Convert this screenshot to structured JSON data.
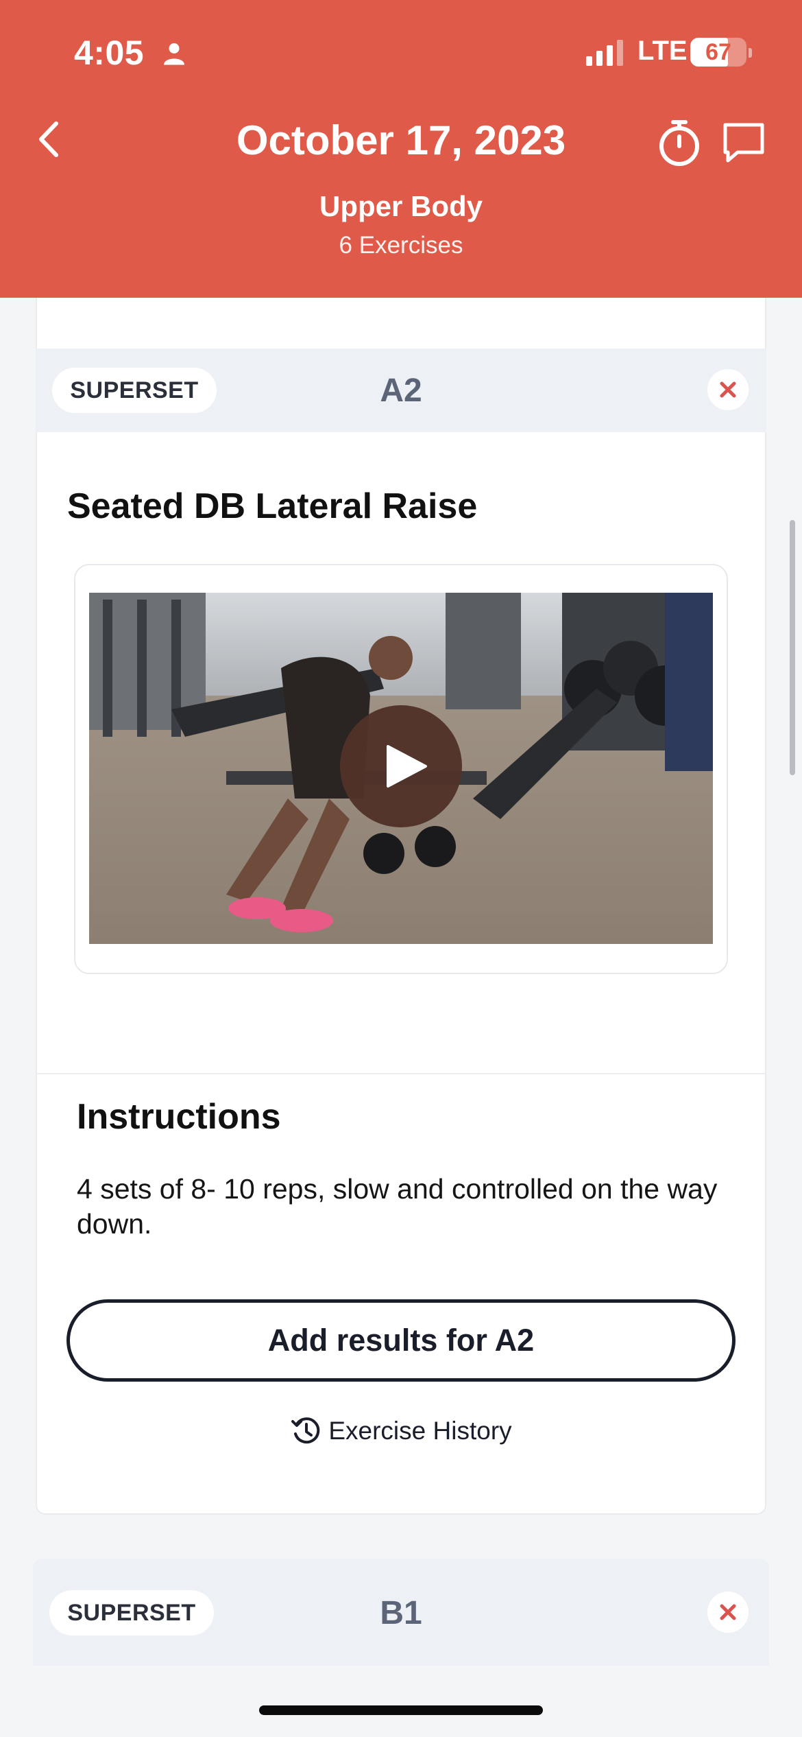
{
  "status_bar": {
    "time": "4:05",
    "network": "LTE",
    "battery": "67",
    "battery_level": 0.67
  },
  "nav": {
    "title": "October 17, 2023",
    "workout_name": "Upper Body",
    "exercise_count": "6 Exercises"
  },
  "supersets": [
    {
      "tag": "SUPERSET",
      "label": "A2"
    },
    {
      "tag": "SUPERSET",
      "label": "B1"
    }
  ],
  "exercise": {
    "title": "Seated DB Lateral Raise",
    "instructions_heading": "Instructions",
    "instructions_text": "4 sets of 8- 10 reps, slow and controlled on the way down.",
    "add_results_label": "Add results for A2",
    "history_label": "Exercise History"
  },
  "colors": {
    "header": "#df5a48",
    "close_x": "#d9534f",
    "button_border": "#1a1d2a"
  }
}
